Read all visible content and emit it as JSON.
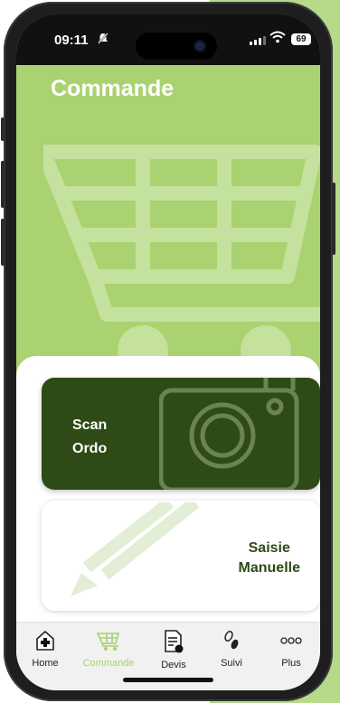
{
  "status_bar": {
    "time": "09:11",
    "battery": "69"
  },
  "page": {
    "title": "Commande"
  },
  "cards": {
    "scan": {
      "line1": "Scan",
      "line2": "Ordo"
    },
    "manual": {
      "line1": "Saisie",
      "line2": "Manuelle"
    }
  },
  "tabbar": {
    "items": [
      {
        "label": "Home",
        "icon": "medical-kit-icon"
      },
      {
        "label": "Commande",
        "icon": "shopping-cart-icon",
        "active": true
      },
      {
        "label": "Devis",
        "icon": "document-icon"
      },
      {
        "label": "Suivi",
        "icon": "footsteps-icon"
      },
      {
        "label": "Plus",
        "icon": "more-dots-icon"
      }
    ]
  },
  "colors": {
    "accent_green": "#aad270",
    "dark_green": "#2e4a16",
    "active_tab": "#a9d06e"
  }
}
